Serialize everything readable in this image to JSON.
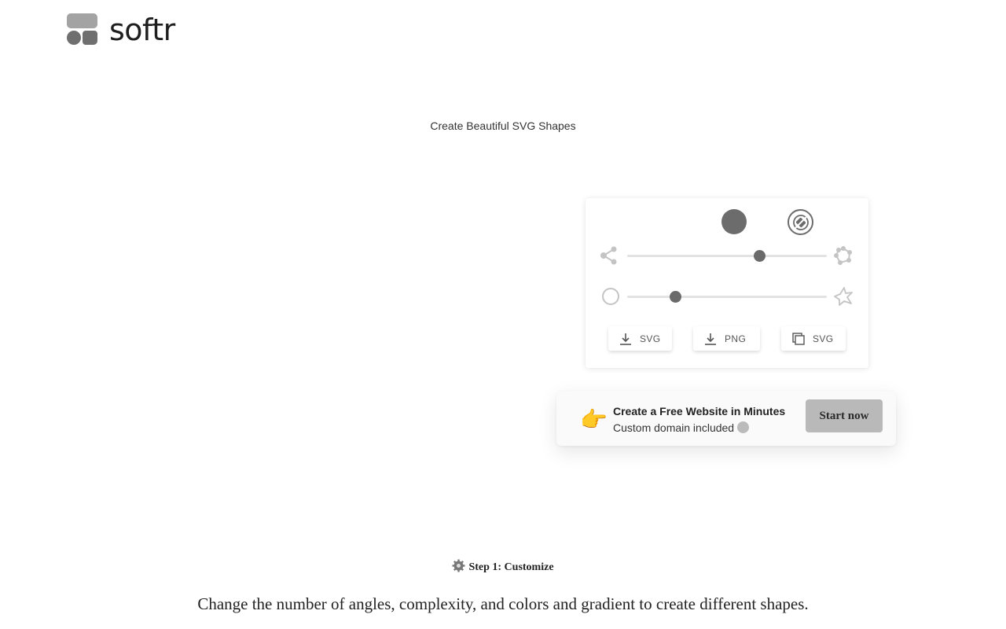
{
  "brand": {
    "name": "softr"
  },
  "page": {
    "title": "Create Beautiful SVG Shapes"
  },
  "controls": {
    "complexity_slider": {
      "value": 0.66
    },
    "randomness_slider": {
      "value": 0.24
    },
    "buttons": [
      {
        "label": "SVG",
        "icon": "download-icon"
      },
      {
        "label": "PNG",
        "icon": "download-icon"
      },
      {
        "label": "SVG",
        "icon": "copy-icon"
      }
    ]
  },
  "promo": {
    "title": "Create a Free Website in Minutes",
    "subtitle": "Custom domain included",
    "cta": "Start now",
    "hand_icon": "👉",
    "subtitle_icon": "wink-emoji"
  },
  "step": {
    "title": "Step 1: Customize",
    "icon": "gear-icon",
    "description": "Change the number of angles, complexity, and colors and gradient to create different shapes."
  }
}
